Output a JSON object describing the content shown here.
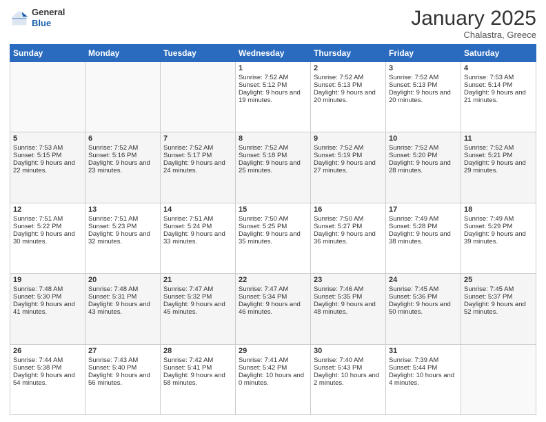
{
  "logo": {
    "general": "General",
    "blue": "Blue"
  },
  "header": {
    "month": "January 2025",
    "location": "Chalastra, Greece"
  },
  "weekdays": [
    "Sunday",
    "Monday",
    "Tuesday",
    "Wednesday",
    "Thursday",
    "Friday",
    "Saturday"
  ],
  "weeks": [
    [
      {
        "day": "",
        "sunrise": "",
        "sunset": "",
        "daylight": ""
      },
      {
        "day": "",
        "sunrise": "",
        "sunset": "",
        "daylight": ""
      },
      {
        "day": "",
        "sunrise": "",
        "sunset": "",
        "daylight": ""
      },
      {
        "day": "1",
        "sunrise": "Sunrise: 7:52 AM",
        "sunset": "Sunset: 5:12 PM",
        "daylight": "Daylight: 9 hours and 19 minutes."
      },
      {
        "day": "2",
        "sunrise": "Sunrise: 7:52 AM",
        "sunset": "Sunset: 5:13 PM",
        "daylight": "Daylight: 9 hours and 20 minutes."
      },
      {
        "day": "3",
        "sunrise": "Sunrise: 7:52 AM",
        "sunset": "Sunset: 5:13 PM",
        "daylight": "Daylight: 9 hours and 20 minutes."
      },
      {
        "day": "4",
        "sunrise": "Sunrise: 7:53 AM",
        "sunset": "Sunset: 5:14 PM",
        "daylight": "Daylight: 9 hours and 21 minutes."
      }
    ],
    [
      {
        "day": "5",
        "sunrise": "Sunrise: 7:53 AM",
        "sunset": "Sunset: 5:15 PM",
        "daylight": "Daylight: 9 hours and 22 minutes."
      },
      {
        "day": "6",
        "sunrise": "Sunrise: 7:52 AM",
        "sunset": "Sunset: 5:16 PM",
        "daylight": "Daylight: 9 hours and 23 minutes."
      },
      {
        "day": "7",
        "sunrise": "Sunrise: 7:52 AM",
        "sunset": "Sunset: 5:17 PM",
        "daylight": "Daylight: 9 hours and 24 minutes."
      },
      {
        "day": "8",
        "sunrise": "Sunrise: 7:52 AM",
        "sunset": "Sunset: 5:18 PM",
        "daylight": "Daylight: 9 hours and 25 minutes."
      },
      {
        "day": "9",
        "sunrise": "Sunrise: 7:52 AM",
        "sunset": "Sunset: 5:19 PM",
        "daylight": "Daylight: 9 hours and 27 minutes."
      },
      {
        "day": "10",
        "sunrise": "Sunrise: 7:52 AM",
        "sunset": "Sunset: 5:20 PM",
        "daylight": "Daylight: 9 hours and 28 minutes."
      },
      {
        "day": "11",
        "sunrise": "Sunrise: 7:52 AM",
        "sunset": "Sunset: 5:21 PM",
        "daylight": "Daylight: 9 hours and 29 minutes."
      }
    ],
    [
      {
        "day": "12",
        "sunrise": "Sunrise: 7:51 AM",
        "sunset": "Sunset: 5:22 PM",
        "daylight": "Daylight: 9 hours and 30 minutes."
      },
      {
        "day": "13",
        "sunrise": "Sunrise: 7:51 AM",
        "sunset": "Sunset: 5:23 PM",
        "daylight": "Daylight: 9 hours and 32 minutes."
      },
      {
        "day": "14",
        "sunrise": "Sunrise: 7:51 AM",
        "sunset": "Sunset: 5:24 PM",
        "daylight": "Daylight: 9 hours and 33 minutes."
      },
      {
        "day": "15",
        "sunrise": "Sunrise: 7:50 AM",
        "sunset": "Sunset: 5:25 PM",
        "daylight": "Daylight: 9 hours and 35 minutes."
      },
      {
        "day": "16",
        "sunrise": "Sunrise: 7:50 AM",
        "sunset": "Sunset: 5:27 PM",
        "daylight": "Daylight: 9 hours and 36 minutes."
      },
      {
        "day": "17",
        "sunrise": "Sunrise: 7:49 AM",
        "sunset": "Sunset: 5:28 PM",
        "daylight": "Daylight: 9 hours and 38 minutes."
      },
      {
        "day": "18",
        "sunrise": "Sunrise: 7:49 AM",
        "sunset": "Sunset: 5:29 PM",
        "daylight": "Daylight: 9 hours and 39 minutes."
      }
    ],
    [
      {
        "day": "19",
        "sunrise": "Sunrise: 7:48 AM",
        "sunset": "Sunset: 5:30 PM",
        "daylight": "Daylight: 9 hours and 41 minutes."
      },
      {
        "day": "20",
        "sunrise": "Sunrise: 7:48 AM",
        "sunset": "Sunset: 5:31 PM",
        "daylight": "Daylight: 9 hours and 43 minutes."
      },
      {
        "day": "21",
        "sunrise": "Sunrise: 7:47 AM",
        "sunset": "Sunset: 5:32 PM",
        "daylight": "Daylight: 9 hours and 45 minutes."
      },
      {
        "day": "22",
        "sunrise": "Sunrise: 7:47 AM",
        "sunset": "Sunset: 5:34 PM",
        "daylight": "Daylight: 9 hours and 46 minutes."
      },
      {
        "day": "23",
        "sunrise": "Sunrise: 7:46 AM",
        "sunset": "Sunset: 5:35 PM",
        "daylight": "Daylight: 9 hours and 48 minutes."
      },
      {
        "day": "24",
        "sunrise": "Sunrise: 7:45 AM",
        "sunset": "Sunset: 5:36 PM",
        "daylight": "Daylight: 9 hours and 50 minutes."
      },
      {
        "day": "25",
        "sunrise": "Sunrise: 7:45 AM",
        "sunset": "Sunset: 5:37 PM",
        "daylight": "Daylight: 9 hours and 52 minutes."
      }
    ],
    [
      {
        "day": "26",
        "sunrise": "Sunrise: 7:44 AM",
        "sunset": "Sunset: 5:38 PM",
        "daylight": "Daylight: 9 hours and 54 minutes."
      },
      {
        "day": "27",
        "sunrise": "Sunrise: 7:43 AM",
        "sunset": "Sunset: 5:40 PM",
        "daylight": "Daylight: 9 hours and 56 minutes."
      },
      {
        "day": "28",
        "sunrise": "Sunrise: 7:42 AM",
        "sunset": "Sunset: 5:41 PM",
        "daylight": "Daylight: 9 hours and 58 minutes."
      },
      {
        "day": "29",
        "sunrise": "Sunrise: 7:41 AM",
        "sunset": "Sunset: 5:42 PM",
        "daylight": "Daylight: 10 hours and 0 minutes."
      },
      {
        "day": "30",
        "sunrise": "Sunrise: 7:40 AM",
        "sunset": "Sunset: 5:43 PM",
        "daylight": "Daylight: 10 hours and 2 minutes."
      },
      {
        "day": "31",
        "sunrise": "Sunrise: 7:39 AM",
        "sunset": "Sunset: 5:44 PM",
        "daylight": "Daylight: 10 hours and 4 minutes."
      },
      {
        "day": "",
        "sunrise": "",
        "sunset": "",
        "daylight": ""
      }
    ]
  ]
}
